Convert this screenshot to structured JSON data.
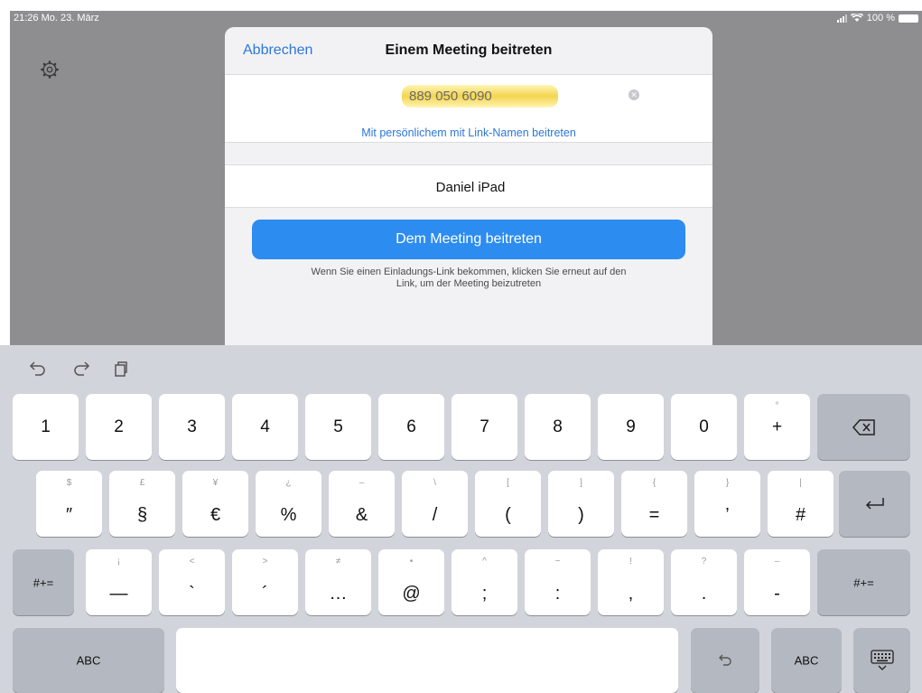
{
  "status_bar": {
    "time_date": "21:26  Mo. 23. März",
    "battery": "100 %"
  },
  "modal": {
    "cancel_label": "Abbrechen",
    "title": "Einem Meeting beitreten",
    "meeting_id": "889 050 6090",
    "personal_link_label": "Mit persönlichem mit Link-Namen beitreten",
    "display_name": "Daniel iPad",
    "join_button": "Dem Meeting beitreten",
    "hint_line1": "Wenn Sie einen Einladungs-Link bekommen, klicken Sie erneut auf den",
    "hint_line2": "Link, um der Meeting beizutreten"
  },
  "keyboard": {
    "row1": [
      "1",
      "2",
      "3",
      "4",
      "5",
      "6",
      "7",
      "8",
      "9",
      "0",
      "+"
    ],
    "row1_sub": [
      "",
      "",
      "",
      "",
      "",
      "",
      "",
      "",
      "",
      "",
      "°"
    ],
    "row2": [
      "″",
      "§",
      "€",
      "%",
      "&",
      "/",
      "(",
      ")",
      "=",
      "’",
      "#"
    ],
    "row2_sub": [
      "$",
      "£",
      "¥",
      "¿",
      "–",
      "\\",
      "[",
      "]",
      "{",
      "}",
      "|"
    ],
    "row3": [
      "—",
      "`",
      "´",
      "…",
      "@",
      ";",
      ":",
      "‚",
      ".",
      "-"
    ],
    "row3_sub": [
      "¡",
      "<",
      ">",
      "≠",
      "•",
      "^",
      "~",
      "!",
      "?",
      "–"
    ],
    "symbols_label": "#+=",
    "abc_label": "ABC"
  },
  "colors": {
    "accent": "#2d8cf0",
    "link": "#2d77d6",
    "highlight": "#f3d54f"
  }
}
